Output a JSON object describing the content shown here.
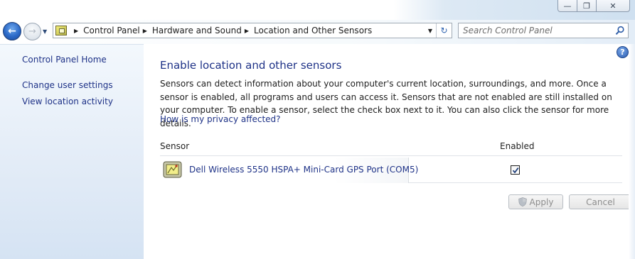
{
  "window": {
    "minimize_glyph": "—",
    "maximize_glyph": "❐",
    "close_glyph": "✕"
  },
  "nav": {
    "back_icon": "back-arrow-icon",
    "forward_icon": "forward-arrow-icon",
    "breadcrumbs": [
      "Control Panel",
      "Hardware and Sound",
      "Location and Other Sensors"
    ],
    "search_placeholder": "Search Control Panel"
  },
  "sidebar": {
    "home": "Control Panel Home",
    "items": [
      "Change user settings",
      "View location activity"
    ]
  },
  "main": {
    "title": "Enable location and other sensors",
    "description": "Sensors can detect information about your computer's current location, surroundings, and more. Once a sensor is enabled, all programs and users can access it. Sensors that are not enabled are still installed on your computer. To enable a sensor, select the check box next to it. You can also click the sensor for more details.",
    "privacy_link": "How is my privacy affected?",
    "columns": {
      "sensor": "Sensor",
      "enabled": "Enabled"
    },
    "sensors": [
      {
        "name": "Dell Wireless 5550 HSPA+ Mini-Card GPS Port (COM5)",
        "enabled": true
      }
    ],
    "buttons": {
      "apply": "Apply",
      "cancel": "Cancel"
    }
  },
  "colors": {
    "link": "#1e3287",
    "sidebar_top": "#f3f8fd",
    "sidebar_bottom": "#d5e3f3"
  }
}
